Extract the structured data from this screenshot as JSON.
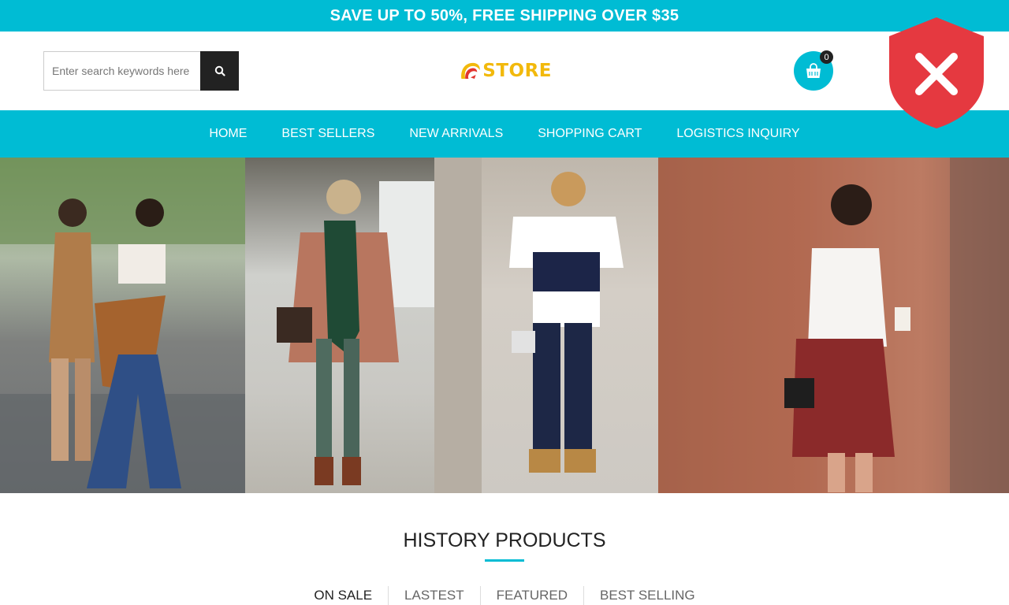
{
  "promo": {
    "text": "SAVE UP TO 50%, FREE SHIPPING OVER $35"
  },
  "search": {
    "placeholder": "Enter search keywords here",
    "button_icon": "search-icon"
  },
  "logo": {
    "text": "STORE"
  },
  "cart": {
    "count": "0",
    "icon": "shopping-bag-icon"
  },
  "security_badge": {
    "icon": "shield-x-icon",
    "color": "#e53940"
  },
  "nav": {
    "items": [
      {
        "label": "HOME"
      },
      {
        "label": "BEST SELLERS"
      },
      {
        "label": "NEW ARRIVALS"
      },
      {
        "label": "SHOPPING CART"
      },
      {
        "label": "LOGISTICS INQUIRY"
      }
    ]
  },
  "colors": {
    "accent": "#00bcd4",
    "dark": "#222222",
    "logo": "#f2b90c"
  },
  "section": {
    "title": "HISTORY PRODUCTS",
    "tabs": [
      {
        "label": "ON SALE"
      },
      {
        "label": "LASTEST"
      },
      {
        "label": "FEATURED"
      },
      {
        "label": "BEST SELLING"
      }
    ]
  }
}
